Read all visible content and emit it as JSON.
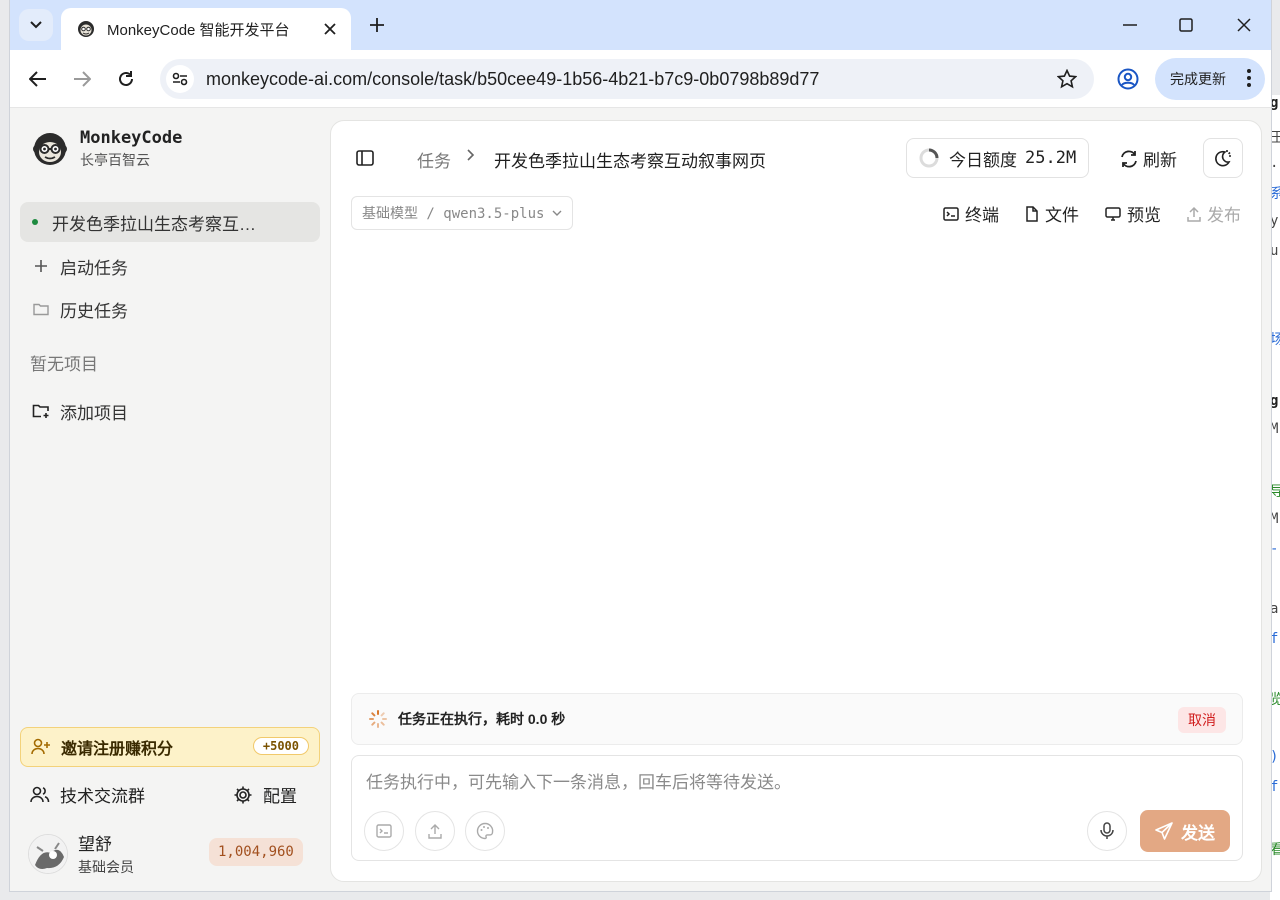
{
  "browser": {
    "tab_title": "MonkeyCode 智能开发平台",
    "url": "monkeycode-ai.com/console/task/b50cee49-1b56-4b21-b7c9-0b0798b89d77",
    "update_label": "完成更新"
  },
  "sidebar": {
    "brand_name": "MonkeyCode",
    "brand_sub": "长亭百智云",
    "active_task": "开发色季拉山生态考察互…",
    "start_task": "启动任务",
    "history_task": "历史任务",
    "no_project": "暂无项目",
    "add_project": "添加项目",
    "invite_label": "邀请注册赚积分",
    "invite_badge": "+5000",
    "community": "技术交流群",
    "settings": "配置",
    "user_name": "望舒",
    "user_role": "基础会员",
    "points": "1,004,960"
  },
  "header": {
    "crumb_root": "任务",
    "crumb_current": "开发色季拉山生态考察互动叙事网页",
    "quota_label": "今日额度",
    "quota_value": "25.2M",
    "refresh_label": "刷新"
  },
  "model": {
    "label": "基础模型 / qwen3.5-plus"
  },
  "tools": {
    "terminal": "终端",
    "files": "文件",
    "preview": "预览",
    "publish": "发布"
  },
  "status": {
    "text": "任务正在执行，耗时 0.0 秒",
    "cancel": "取消"
  },
  "composer": {
    "placeholder": "任务执行中，可先输入下一条消息，回车后将等待发送。",
    "send": "发送"
  },
  "colors": {
    "accent": "#e3a884",
    "active_dot": "#1d8a3f",
    "cancel_red": "#d11e1e"
  }
}
